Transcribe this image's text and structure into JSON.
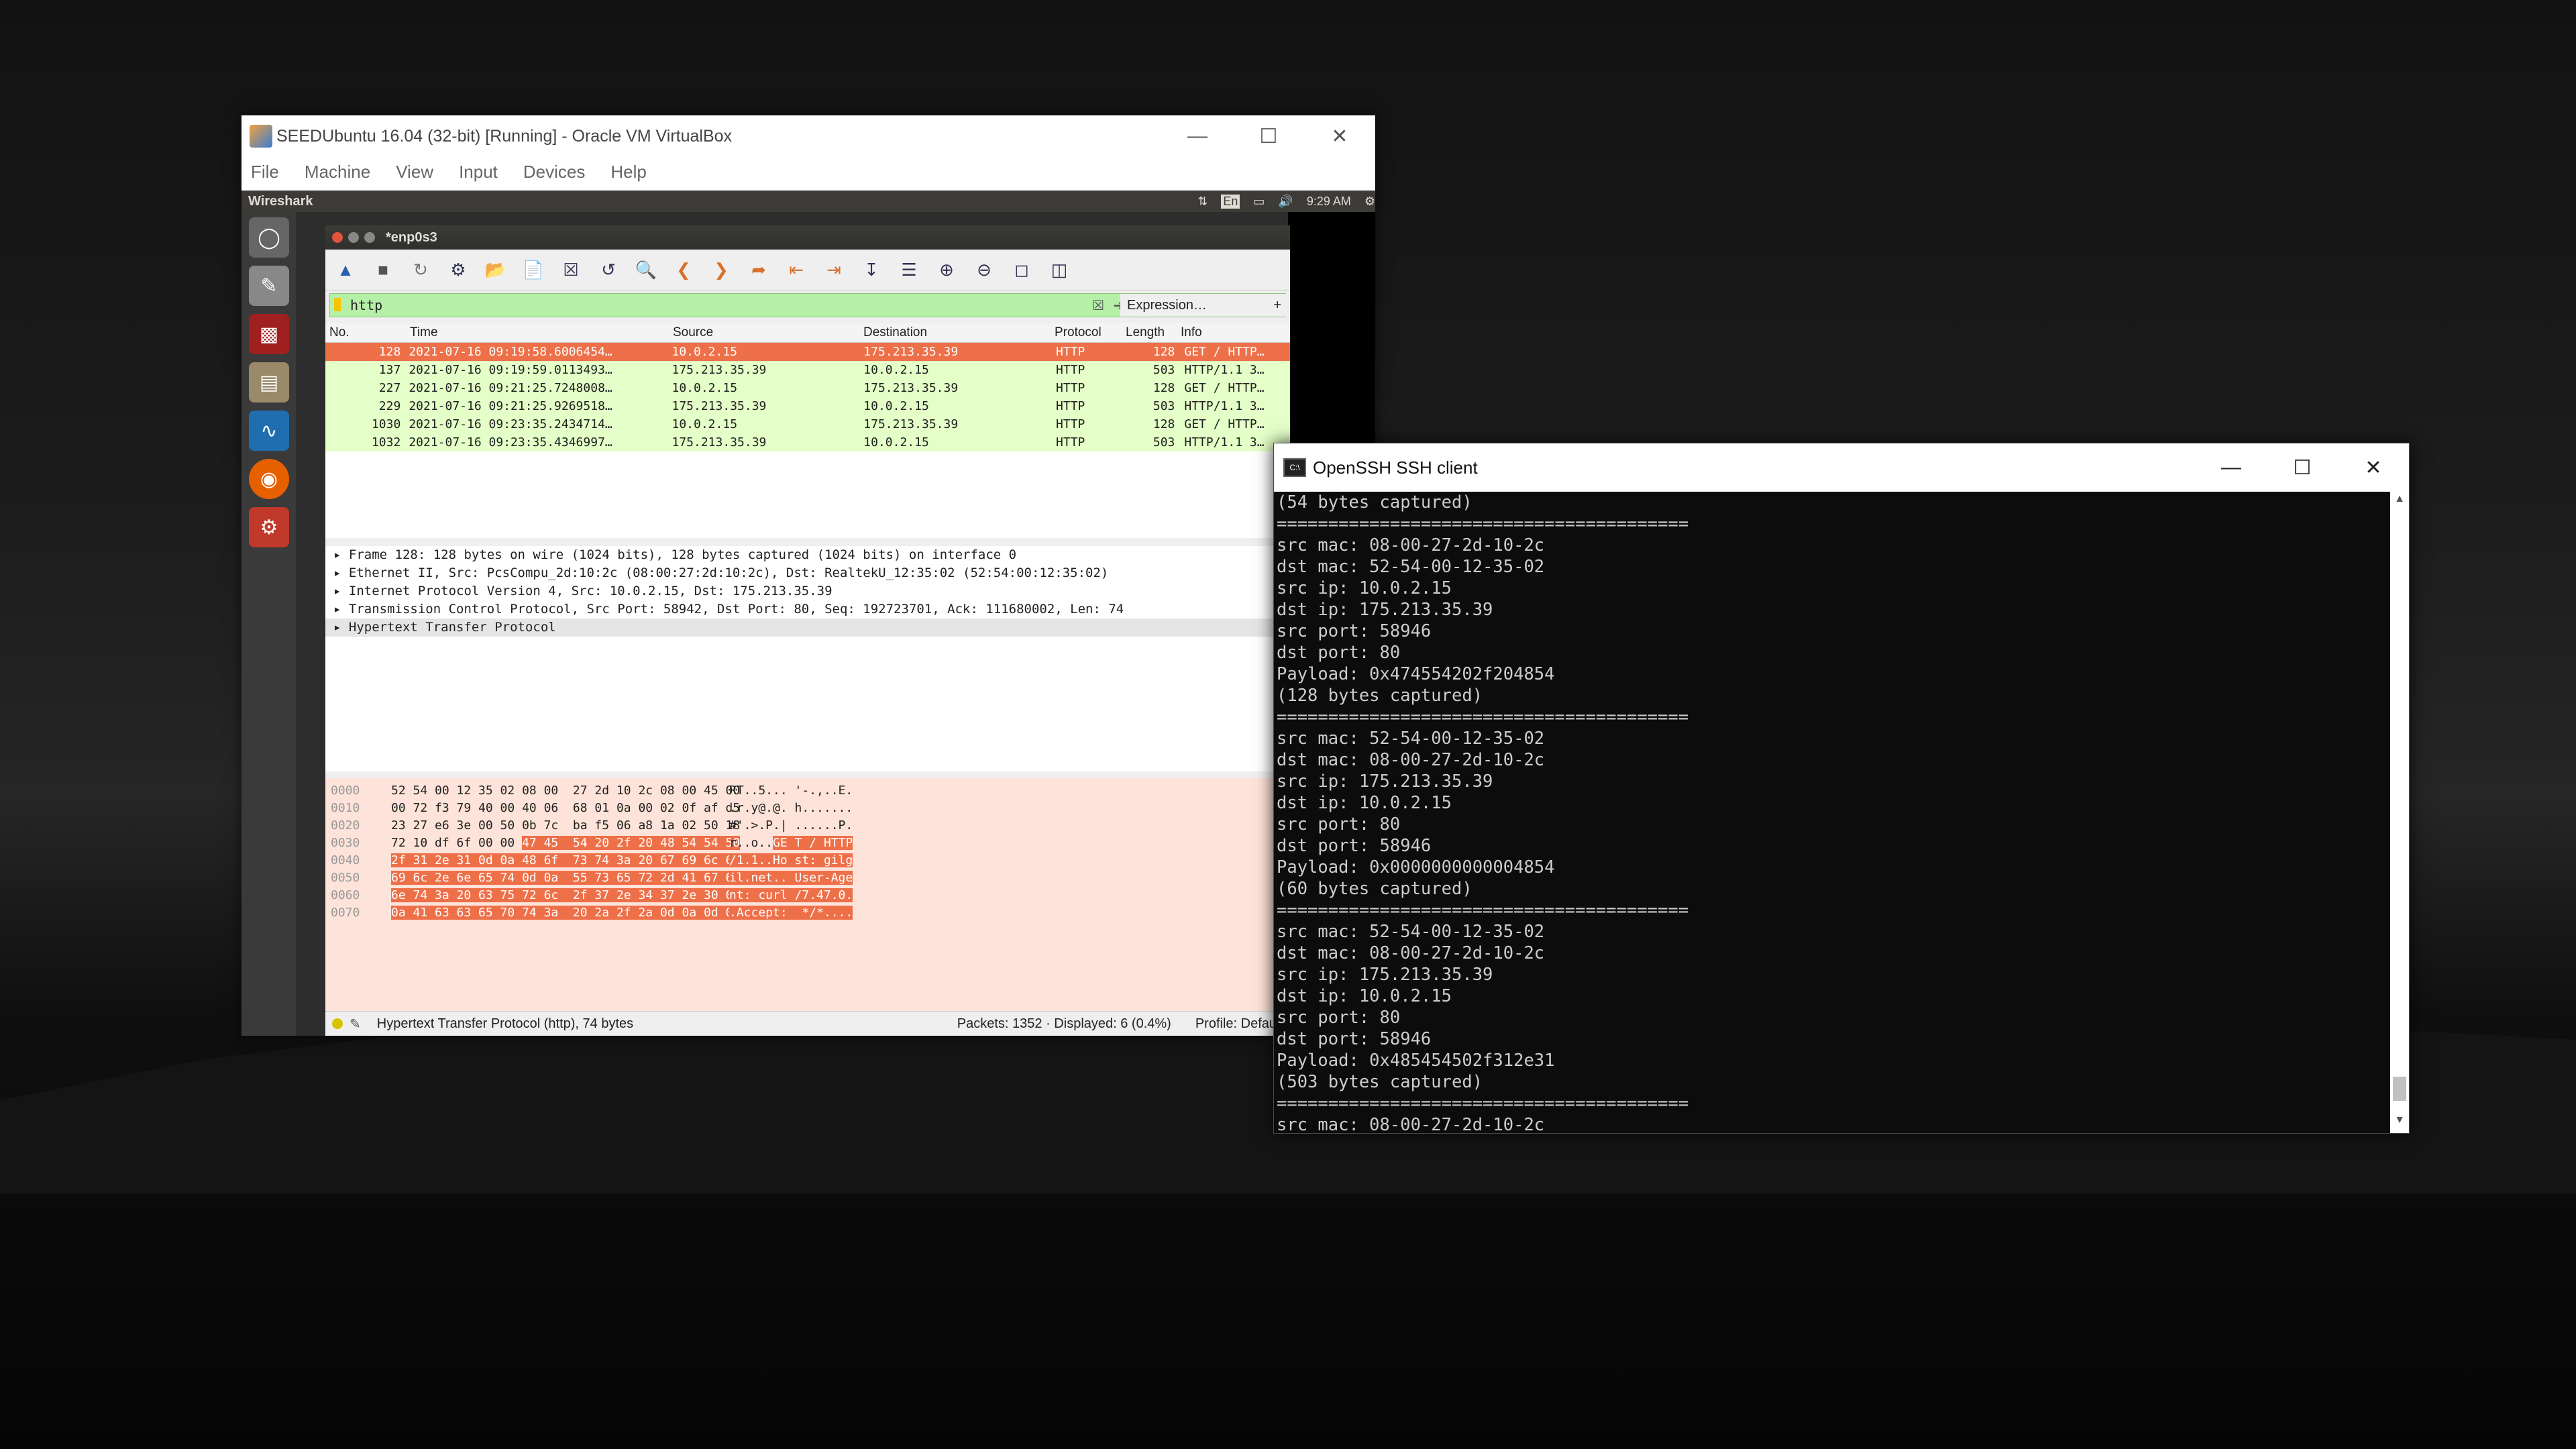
{
  "vbox": {
    "title": "SEEDUbuntu 16.04 (32-bit) [Running] - Oracle VM VirtualBox",
    "menu": [
      "File",
      "Machine",
      "View",
      "Input",
      "Devices",
      "Help"
    ]
  },
  "ubuntu": {
    "app_name": "Wireshark",
    "lang": "En",
    "clock": "9:29 AM"
  },
  "wireshark": {
    "title": "*enp0s3",
    "filter": "http",
    "expression_label": "Expression…",
    "columns": [
      "No.",
      "Time",
      "Source",
      "Destination",
      "Protocol",
      "Length",
      "Info"
    ],
    "packets": [
      {
        "no": "128",
        "time": "2021-07-16 09:19:58.6006454…",
        "src": "10.0.2.15",
        "dst": "175.213.35.39",
        "proto": "HTTP",
        "len": "128",
        "info": "GET / HTTP…"
      },
      {
        "no": "137",
        "time": "2021-07-16 09:19:59.0113493…",
        "src": "175.213.35.39",
        "dst": "10.0.2.15",
        "proto": "HTTP",
        "len": "503",
        "info": "HTTP/1.1 3…"
      },
      {
        "no": "227",
        "time": "2021-07-16 09:21:25.7248008…",
        "src": "10.0.2.15",
        "dst": "175.213.35.39",
        "proto": "HTTP",
        "len": "128",
        "info": "GET / HTTP…"
      },
      {
        "no": "229",
        "time": "2021-07-16 09:21:25.9269518…",
        "src": "175.213.35.39",
        "dst": "10.0.2.15",
        "proto": "HTTP",
        "len": "503",
        "info": "HTTP/1.1 3…"
      },
      {
        "no": "1030",
        "time": "2021-07-16 09:23:35.2434714…",
        "src": "10.0.2.15",
        "dst": "175.213.35.39",
        "proto": "HTTP",
        "len": "128",
        "info": "GET / HTTP…"
      },
      {
        "no": "1032",
        "time": "2021-07-16 09:23:35.4346997…",
        "src": "175.213.35.39",
        "dst": "10.0.2.15",
        "proto": "HTTP",
        "len": "503",
        "info": "HTTP/1.1 3…"
      }
    ],
    "details": [
      "Frame 128: 128 bytes on wire (1024 bits), 128 bytes captured (1024 bits) on interface 0",
      "Ethernet II, Src: PcsCompu_2d:10:2c (08:00:27:2d:10:2c), Dst: RealtekU_12:35:02 (52:54:00:12:35:02)",
      "Internet Protocol Version 4, Src: 10.0.2.15, Dst: 175.213.35.39",
      "Transmission Control Protocol, Src Port: 58942, Dst Port: 80, Seq: 192723701, Ack: 111680002, Len: 74",
      "Hypertext Transfer Protocol"
    ],
    "hex": [
      {
        "off": "0000",
        "pre": "52 54 00 12 35 02 08 00  27 2d 10 2c 08 00 45 00",
        "hl": "",
        "apre": "RT..5... '-.,..E.",
        "ahl": ""
      },
      {
        "off": "0010",
        "pre": "00 72 f3 79 40 00 40 06  68 01 0a 00 02 0f af d5",
        "hl": "",
        "apre": ".r.y@.@. h.......",
        "ahl": ""
      },
      {
        "off": "0020",
        "pre": "23 27 e6 3e 00 50 0b 7c  ba f5 06 a8 1a 02 50 18",
        "hl": "",
        "apre": "#'.>.P.| ......P.",
        "ahl": ""
      },
      {
        "off": "0030",
        "pre": "72 10 df 6f 00 00 ",
        "hl": "47 45  54 20 2f 20 48 54 54 50",
        "apre": "r..o..",
        "ahl": "GE T / HTTP"
      },
      {
        "off": "0040",
        "pre": "",
        "hl": "2f 31 2e 31 0d 0a 48 6f  73 74 3a 20 67 69 6c 67",
        "apre": "",
        "ahl": "/1.1..Ho st: gilg"
      },
      {
        "off": "0050",
        "pre": "",
        "hl": "69 6c 2e 6e 65 74 0d 0a  55 73 65 72 2d 41 67 65",
        "apre": "",
        "ahl": "il.net.. User-Age"
      },
      {
        "off": "0060",
        "pre": "",
        "hl": "6e 74 3a 20 63 75 72 6c  2f 37 2e 34 37 2e 30 0d",
        "apre": "",
        "ahl": "nt: curl /7.47.0."
      },
      {
        "off": "0070",
        "pre": "",
        "hl": "0a 41 63 63 65 70 74 3a  20 2a 2f 2a 0d 0a 0d 0a",
        "apre": "",
        "ahl": ".Accept:  */*...."
      }
    ],
    "status_text": "Hypertext Transfer Protocol (http), 74 bytes",
    "packets_status": "Packets: 1352 · Displayed: 6 (0.4%)",
    "profile": "Profile: Default"
  },
  "ssh": {
    "title": "OpenSSH SSH client",
    "lines": [
      "(54 bytes captured)",
      "========================================",
      "src mac: 08-00-27-2d-10-2c",
      "dst mac: 52-54-00-12-35-02",
      "src ip: 10.0.2.15",
      "dst ip: 175.213.35.39",
      "src port: 58946",
      "dst port: 80",
      "Payload: 0x474554202f204854",
      "(128 bytes captured)",
      "========================================",
      "src mac: 52-54-00-12-35-02",
      "dst mac: 08-00-27-2d-10-2c",
      "src ip: 175.213.35.39",
      "dst ip: 10.0.2.15",
      "src port: 80",
      "dst port: 58946",
      "Payload: 0x0000000000004854",
      "(60 bytes captured)",
      "========================================",
      "src mac: 52-54-00-12-35-02",
      "dst mac: 08-00-27-2d-10-2c",
      "src ip: 175.213.35.39",
      "dst ip: 10.0.2.15",
      "src port: 80",
      "dst port: 58946",
      "Payload: 0x485454502f312e31",
      "(503 bytes captured)",
      "========================================",
      "src mac: 08-00-27-2d-10-2c"
    ]
  }
}
